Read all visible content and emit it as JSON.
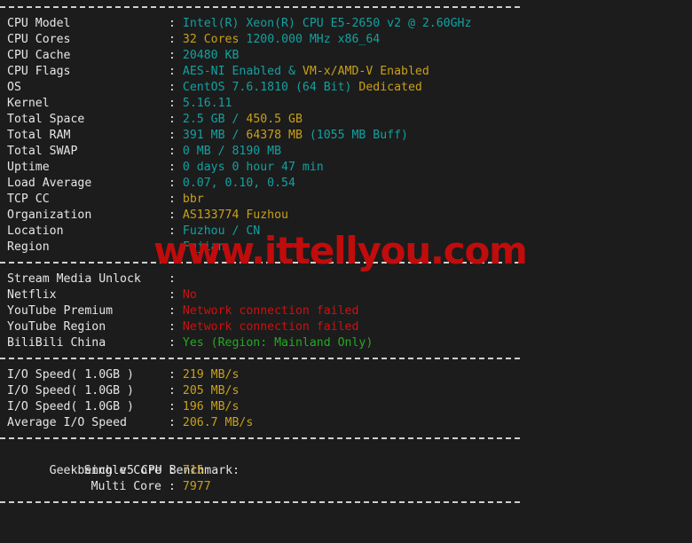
{
  "terminal": {
    "background_color": "#1c1c1c",
    "colors": {
      "label": "#e6e6e6",
      "cyan": "#14a0a0",
      "orange": "#c8a018",
      "red": "#cc1111",
      "green": "#22aa22",
      "watermark": "#c00c0c"
    }
  },
  "watermark": {
    "text": "www.ittellyou.com"
  },
  "separators": {
    "dash_char": "-"
  },
  "sections": {
    "system": {
      "rows": [
        {
          "label": "CPU Model",
          "colon": ":",
          "parts": [
            {
              "text": "Intel(R) Xeon(R) CPU E5-2650 v2 @ 2.60GHz",
              "color": "cyan"
            }
          ]
        },
        {
          "label": "CPU Cores",
          "colon": ":",
          "parts": [
            {
              "text": "32 Cores",
              "color": "orange"
            },
            {
              "text": " 1200.000 MHz x86_64",
              "color": "cyan"
            }
          ]
        },
        {
          "label": "CPU Cache",
          "colon": ":",
          "parts": [
            {
              "text": "20480 KB",
              "color": "cyan"
            }
          ]
        },
        {
          "label": "CPU Flags",
          "colon": ":",
          "parts": [
            {
              "text": "AES-NI Enabled",
              "color": "cyan"
            },
            {
              "text": " & ",
              "color": "cyan"
            },
            {
              "text": "VM-x/AMD-V Enabled",
              "color": "orange"
            }
          ]
        },
        {
          "label": "OS",
          "colon": ":",
          "parts": [
            {
              "text": "CentOS 7.6.1810 (64 Bit) ",
              "color": "cyan"
            },
            {
              "text": "Dedicated",
              "color": "orange"
            }
          ]
        },
        {
          "label": "Kernel",
          "colon": ":",
          "parts": [
            {
              "text": "5.16.11",
              "color": "cyan"
            }
          ]
        },
        {
          "label": "Total Space",
          "colon": ":",
          "parts": [
            {
              "text": "2.5 GB ",
              "color": "cyan"
            },
            {
              "text": "/ ",
              "color": "cyan"
            },
            {
              "text": "450.5 GB",
              "color": "orange"
            }
          ]
        },
        {
          "label": "Total RAM",
          "colon": ":",
          "parts": [
            {
              "text": "391 MB ",
              "color": "cyan"
            },
            {
              "text": "/ ",
              "color": "cyan"
            },
            {
              "text": "64378 MB",
              "color": "orange"
            },
            {
              "text": " (1055 MB Buff)",
              "color": "cyan"
            }
          ]
        },
        {
          "label": "Total SWAP",
          "colon": ":",
          "parts": [
            {
              "text": "0 MB / 8190 MB",
              "color": "cyan"
            }
          ]
        },
        {
          "label": "Uptime",
          "colon": ":",
          "parts": [
            {
              "text": "0 days 0 hour 47 min",
              "color": "cyan"
            }
          ]
        },
        {
          "label": "Load Average",
          "colon": ":",
          "parts": [
            {
              "text": "0.07, 0.10, 0.54",
              "color": "cyan"
            }
          ]
        },
        {
          "label": "TCP CC",
          "colon": ":",
          "parts": [
            {
              "text": "bbr",
              "color": "orange"
            }
          ]
        },
        {
          "label": "Organization",
          "colon": ":",
          "parts": [
            {
              "text": "AS133774 Fuzhou",
              "color": "orange"
            }
          ]
        },
        {
          "label": "Location",
          "colon": ":",
          "parts": [
            {
              "text": "Fuzhou / CN",
              "color": "cyan"
            }
          ]
        },
        {
          "label": "Region",
          "colon": ":",
          "parts": [
            {
              "text": "Fujian",
              "color": "cyan"
            }
          ]
        }
      ]
    },
    "stream_media": {
      "rows": [
        {
          "label": "Stream Media Unlock",
          "colon": ":",
          "parts": [
            {
              "text": "",
              "color": "cyan"
            }
          ]
        },
        {
          "label": "Netflix",
          "colon": ":",
          "parts": [
            {
              "text": "No",
              "color": "red"
            }
          ]
        },
        {
          "label": "YouTube Premium",
          "colon": ":",
          "parts": [
            {
              "text": "Network connection failed",
              "color": "red"
            }
          ]
        },
        {
          "label": "YouTube Region",
          "colon": ":",
          "parts": [
            {
              "text": "Network connection failed",
              "color": "red"
            }
          ]
        },
        {
          "label": "BiliBili China",
          "colon": ":",
          "parts": [
            {
              "text": "Yes (Region: Mainland Only)",
              "color": "green"
            }
          ]
        }
      ]
    },
    "io_speed": {
      "rows": [
        {
          "label": "I/O Speed( 1.0GB )",
          "colon": ":",
          "parts": [
            {
              "text": "219 MB/s",
              "color": "orange"
            }
          ]
        },
        {
          "label": "I/O Speed( 1.0GB )",
          "colon": ":",
          "parts": [
            {
              "text": "205 MB/s",
              "color": "orange"
            }
          ]
        },
        {
          "label": "I/O Speed( 1.0GB )",
          "colon": ":",
          "parts": [
            {
              "text": "196 MB/s",
              "color": "orange"
            }
          ]
        },
        {
          "label": "Average I/O Speed",
          "colon": ":",
          "parts": [
            {
              "text": "206.7 MB/s",
              "color": "orange"
            }
          ]
        }
      ]
    },
    "geekbench": {
      "title": "Geekbench v5 CPU Benchmark:",
      "rows": [
        {
          "label": "Single Core",
          "colon": ":",
          "parts": [
            {
              "text": "715",
              "color": "orange"
            }
          ]
        },
        {
          "label": "Multi Core",
          "colon": ":",
          "parts": [
            {
              "text": "7977",
              "color": "orange"
            }
          ]
        }
      ]
    }
  }
}
